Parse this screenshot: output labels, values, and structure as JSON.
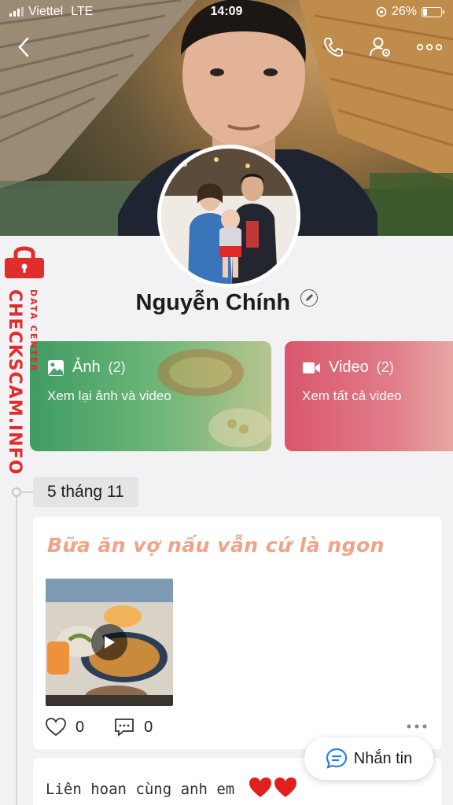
{
  "status_bar": {
    "carrier": "Viettel",
    "network": "LTE",
    "time": "14:09",
    "battery": "26%",
    "battery_level": 0.26
  },
  "profile": {
    "name": "Nguyễn Chính"
  },
  "media": {
    "photos": {
      "label": "Ảnh",
      "count": "(2)",
      "subtitle": "Xem lại ảnh và video"
    },
    "videos": {
      "label": "Video",
      "count": "(2)",
      "subtitle": "Xem tất cả video"
    }
  },
  "watermark": {
    "main": "CHECKSCAM.INFO",
    "sub": "DATA CENTER"
  },
  "timeline": {
    "date": "5 tháng 11",
    "post1": {
      "title": "Bữa ăn vợ nấu vẫn cứ là ngon",
      "likes": "0",
      "comments": "0"
    },
    "post2": {
      "text": "Liên hoan cùng anh em"
    }
  },
  "message_button": {
    "label": "Nhắn tin"
  },
  "icons": {
    "back": "chevron-left-icon",
    "call": "phone-icon",
    "settings": "user-settings-icon",
    "more": "more-icon",
    "photo": "image-icon",
    "video": "video-camera-icon",
    "like": "heart-icon",
    "comment": "comment-icon",
    "chat": "chat-bubble-icon",
    "lock": "lock-icon"
  },
  "colors": {
    "post_title": "#f0a386",
    "photos_card": "#3f9c63",
    "videos_card": "#d9566b",
    "watermark": "#e22d2d"
  }
}
